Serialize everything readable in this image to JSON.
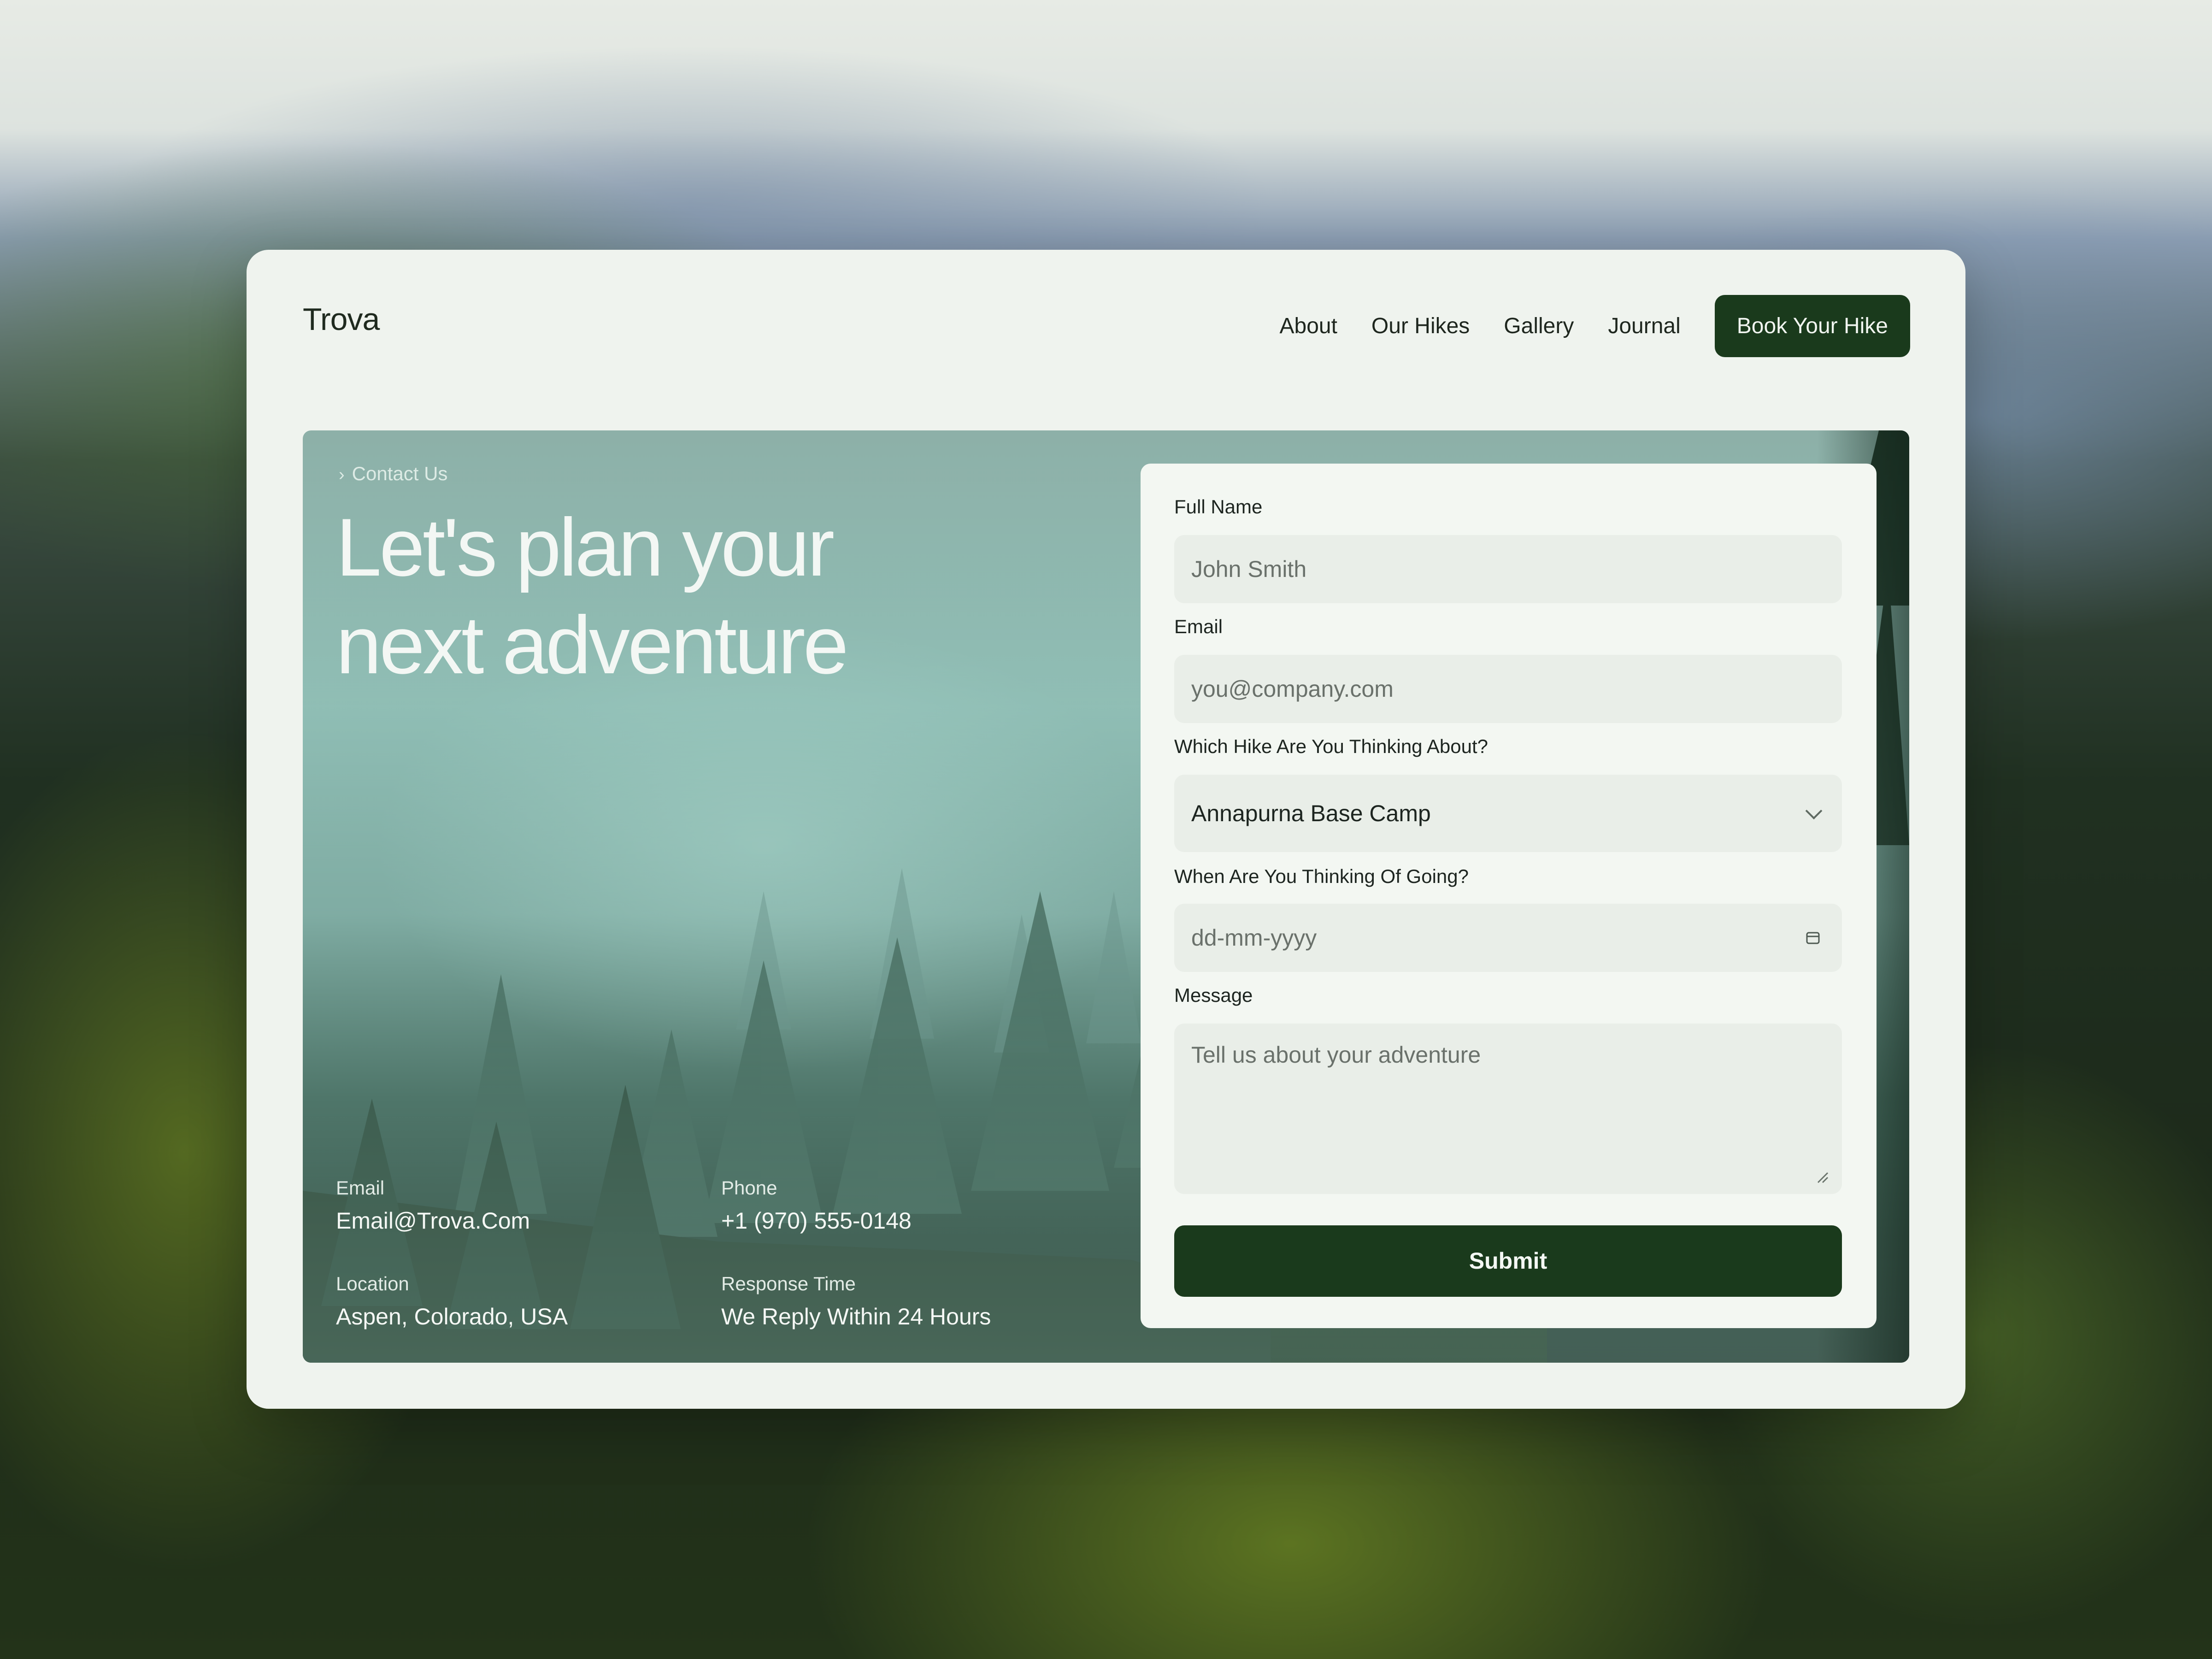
{
  "brand": "Trova",
  "nav": {
    "items": [
      "About",
      "Our Hikes",
      "Gallery",
      "Journal"
    ],
    "cta": "Book Your Hike"
  },
  "hero": {
    "breadcrumb": "Contact Us",
    "headline_line1": "Let's plan your",
    "headline_line2": "next adventure"
  },
  "contact": {
    "email_label": "Email",
    "email_value": "Email@Trova.Com",
    "phone_label": "Phone",
    "phone_value": "+1 (970) 555-0148",
    "location_label": "Location",
    "location_value": "Aspen, Colorado, USA",
    "response_label": "Response Time",
    "response_value": "We Reply Within 24 Hours"
  },
  "form": {
    "full_name_label": "Full Name",
    "full_name_placeholder": "John Smith",
    "email_label": "Email",
    "email_placeholder": "you@company.com",
    "hike_label": "Which Hike Are You Thinking About?",
    "hike_selected": "Annapurna Base Camp",
    "date_label": "When Are You Thinking Of Going?",
    "date_placeholder": "dd-mm-yyyy",
    "message_label": "Message",
    "message_placeholder": "Tell us about your adventure",
    "submit_label": "Submit"
  },
  "colors": {
    "primary": "#1a3a1c",
    "card_bg": "#eff3ee",
    "input_bg": "#e9eee8"
  },
  "icons": {
    "breadcrumb": "chevron-right-icon",
    "select": "chevron-down-icon",
    "date": "calendar-icon",
    "textarea": "resize-grip-icon"
  }
}
